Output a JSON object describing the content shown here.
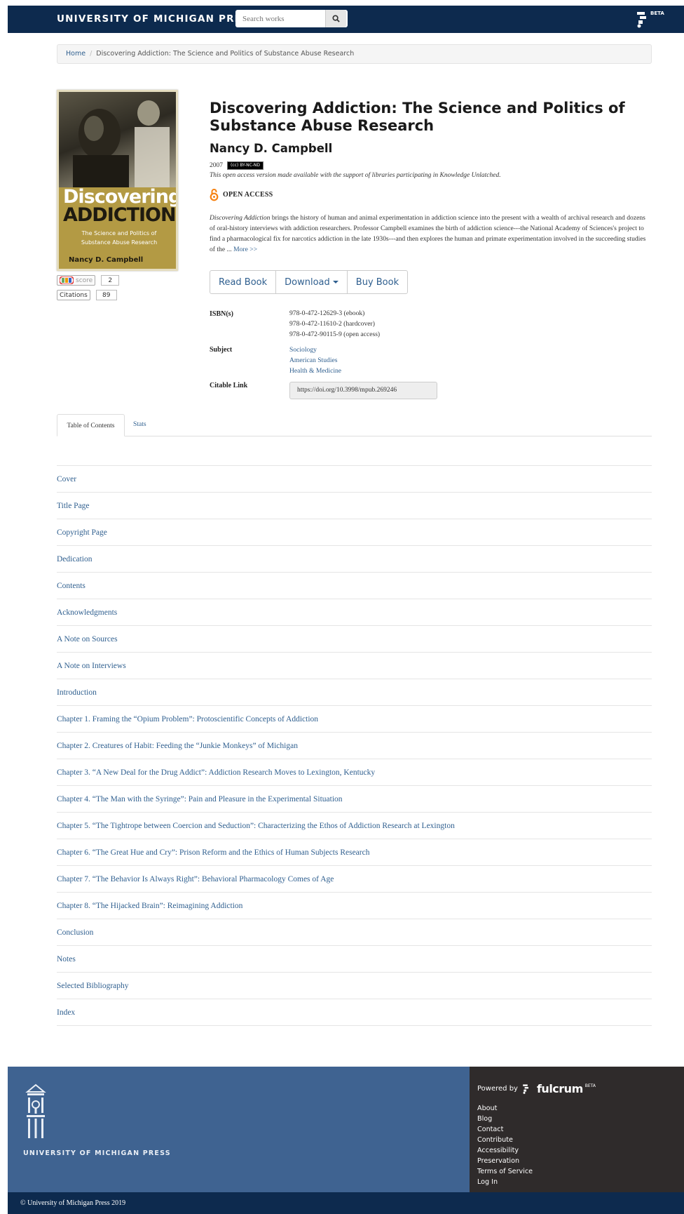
{
  "header": {
    "brand": "UNIVERSITY OF MICHIGAN PRESS",
    "search_placeholder": "Search works",
    "beta": "BETA"
  },
  "breadcrumb": {
    "home": "Home",
    "current": "Discovering Addiction: The Science and Politics of Substance Abuse Research"
  },
  "cover": {
    "title_line1": "Discovering",
    "title_line2": "ADDICTION",
    "subtitle_line1": "The Science and Politics of",
    "subtitle_line2": "Substance Abuse Research",
    "author": "Nancy D. Campbell"
  },
  "badges": {
    "altmetric_label": "score",
    "altmetric_count": "2",
    "citations_label": "Citations",
    "citations_count": "89"
  },
  "book": {
    "title": "Discovering Addiction: The Science and Politics of Substance Abuse Research",
    "author": "Nancy D. Campbell",
    "year": "2007",
    "license": "BY-NC-ND",
    "oa_note": "This open access version made available with the support of libraries participating in Knowledge Unlatched.",
    "open_access": "OPEN ACCESS",
    "description_italic": "Discovering Addiction",
    "description": " brings the history of human and animal experimentation in addiction science into the present with a wealth of archival research and dozens of oral-history interviews with addiction researchers. Professor Campbell examines the birth of addiction science---the National Academy of Sciences's project to find a pharmacological fix for narcotics addiction in the late 1930s---and then explores the human and primate experimentation involved in the succeeding studies of the ... ",
    "more": "More >>"
  },
  "actions": {
    "read": "Read Book",
    "download": "Download",
    "buy": "Buy Book"
  },
  "meta": {
    "isbn_label": "ISBN(s)",
    "isbns": [
      "978-0-472-12629-3 (ebook)",
      "978-0-472-11610-2 (hardcover)",
      "978-0-472-90115-9 (open access)"
    ],
    "subject_label": "Subject",
    "subjects": [
      "Sociology",
      "American Studies",
      "Health & Medicine"
    ],
    "citable_label": "Citable Link",
    "doi": "https://doi.org/10.3998/mpub.269246"
  },
  "tabs": {
    "toc": "Table of Contents",
    "stats": "Stats"
  },
  "toc": [
    "Cover",
    "Title Page",
    "Copyright Page",
    "Dedication",
    "Contents",
    "Acknowledgments",
    "A Note on Sources",
    "A Note on Interviews",
    "Introduction",
    "Chapter 1. Framing the “Opium Problem”: Protoscientific Concepts of Addiction",
    "Chapter 2. Creatures of Habit: Feeding the “Junkie Monkeys” of Michigan",
    "Chapter 3. “A New Deal for the Drug Addict”: Addiction Research Moves to Lexington, Kentucky",
    "Chapter 4. “The Man with the Syringe”: Pain and Pleasure in the Experimental Situation",
    "Chapter 5. “The Tightrope between Coercion and Seduction”: Characterizing the Ethos of Addiction Research at Lexington",
    "Chapter 6. “The Great Hue and Cry”: Prison Reform and the Ethics of Human Subjects Research",
    "Chapter 7. “The Behavior Is Always Right”: Behavioral Pharmacology Comes of Age",
    "Chapter 8. “The Hijacked Brain”: Reimagining Addiction",
    "Conclusion",
    "Notes",
    "Selected Bibliography",
    "Index"
  ],
  "footer": {
    "press_name": "UNIVERSITY OF MICHIGAN PRESS",
    "powered_by": "Powered by",
    "fulcrum": "fulcrum",
    "fulcrum_beta": "BETA",
    "links": [
      "About",
      "Blog",
      "Contact",
      "Contribute",
      "Accessibility",
      "Preservation",
      "Terms of Service",
      "Log In"
    ],
    "copyright": "© University of Michigan Press 2019"
  },
  "colors": {
    "navy": "#0d2a4e",
    "link": "#2f5f8f",
    "footer_blue": "#3f6391",
    "footer_dark": "#2f2b2b",
    "open_access_orange": "#f68212"
  }
}
